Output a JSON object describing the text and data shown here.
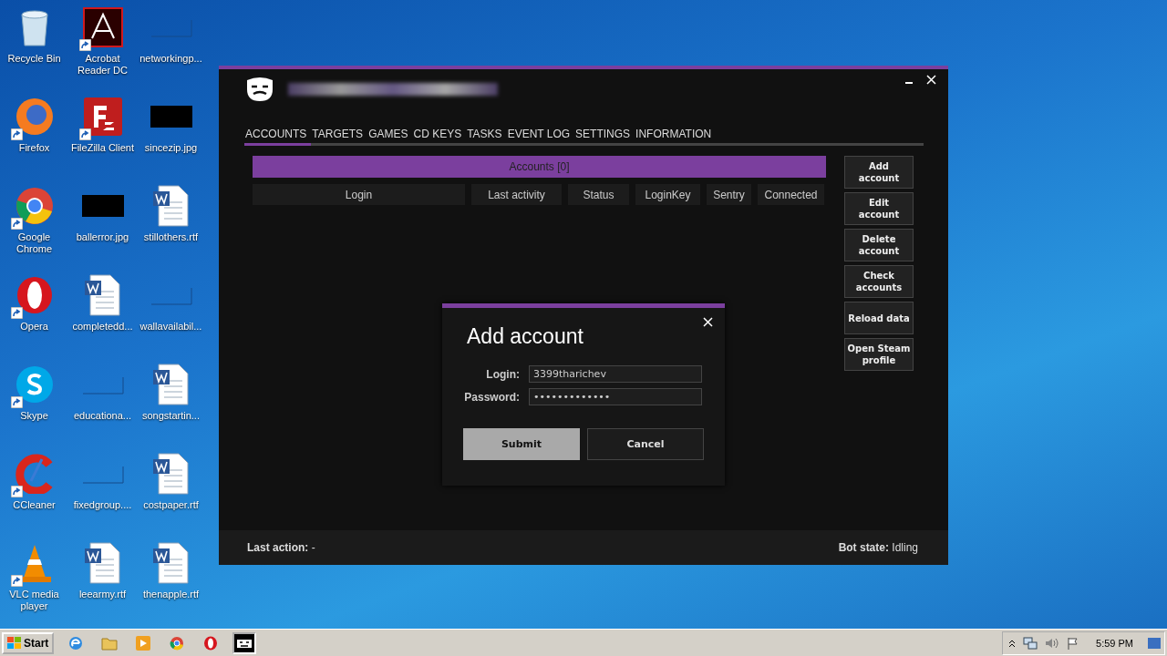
{
  "desktop_icons": [
    {
      "label": "Recycle Bin",
      "kind": "recycle",
      "shortcut": false
    },
    {
      "label": "Acrobat Reader DC",
      "kind": "acrobat",
      "shortcut": true
    },
    {
      "label": "networkingp...",
      "kind": "blank",
      "shortcut": false
    },
    {
      "label": "Firefox",
      "kind": "firefox",
      "shortcut": true
    },
    {
      "label": "FileZilla Client",
      "kind": "filezilla",
      "shortcut": true
    },
    {
      "label": "sincezip.jpg",
      "kind": "image",
      "shortcut": false
    },
    {
      "label": "Google Chrome",
      "kind": "chrome",
      "shortcut": true
    },
    {
      "label": "ballerror.jpg",
      "kind": "image",
      "shortcut": false
    },
    {
      "label": "stillothers.rtf",
      "kind": "word",
      "shortcut": false
    },
    {
      "label": "Opera",
      "kind": "opera",
      "shortcut": true
    },
    {
      "label": "completedd...",
      "kind": "word",
      "shortcut": false
    },
    {
      "label": "wallavailabil...",
      "kind": "blank",
      "shortcut": false
    },
    {
      "label": "Skype",
      "kind": "skype",
      "shortcut": true
    },
    {
      "label": "educationa...",
      "kind": "blank",
      "shortcut": false
    },
    {
      "label": "songstartin...",
      "kind": "word",
      "shortcut": false
    },
    {
      "label": "CCleaner",
      "kind": "ccleaner",
      "shortcut": true
    },
    {
      "label": "fixedgroup....",
      "kind": "blank",
      "shortcut": false
    },
    {
      "label": "costpaper.rtf",
      "kind": "word",
      "shortcut": false
    },
    {
      "label": "VLC media player",
      "kind": "vlc",
      "shortcut": true
    },
    {
      "label": "leearmy.rtf",
      "kind": "word",
      "shortcut": false
    },
    {
      "label": "thenapple.rtf",
      "kind": "word",
      "shortcut": false
    }
  ],
  "app_window": {
    "tabs": [
      {
        "label": "ACCOUNTS",
        "selected": true
      },
      {
        "label": "TARGETS",
        "selected": false
      },
      {
        "label": "GAMES",
        "selected": false
      },
      {
        "label": "CD KEYS",
        "selected": false
      },
      {
        "label": "TASKS",
        "selected": false
      },
      {
        "label": "EVENT LOG",
        "selected": false
      },
      {
        "label": "SETTINGS",
        "selected": false
      },
      {
        "label": "INFORMATION",
        "selected": false
      }
    ],
    "table": {
      "title": "Accounts [0]",
      "columns": [
        "Login",
        "Last activity",
        "Status",
        "LoginKey",
        "Sentry",
        "Connected"
      ]
    },
    "side_buttons": [
      "Add account",
      "Edit account",
      "Delete account",
      "Check accounts",
      "Reload data",
      "Open Steam profile"
    ],
    "status_bar": {
      "last_action": "**Last action:** -",
      "bot_state": "**Bot state:** Idling"
    },
    "dialog": {
      "title": "Add account",
      "fields": [
        {
          "label": "Login:",
          "value": "3399tharichev"
        },
        {
          "label": "Password:",
          "value": "•••••••••••••"
        }
      ],
      "buttons": [
        {
          "label": "Submit",
          "selected": true
        },
        {
          "label": "Cancel",
          "selected": false
        }
      ]
    }
  },
  "taskbar": {
    "start": "Start",
    "apps": [
      {
        "kind": "ie",
        "selected": false
      },
      {
        "kind": "explorer",
        "selected": false
      },
      {
        "kind": "media",
        "selected": false
      },
      {
        "kind": "chrome",
        "selected": false
      },
      {
        "kind": "opera",
        "selected": false
      },
      {
        "kind": "bot",
        "selected": true
      }
    ],
    "clock": "5:59 PM"
  }
}
